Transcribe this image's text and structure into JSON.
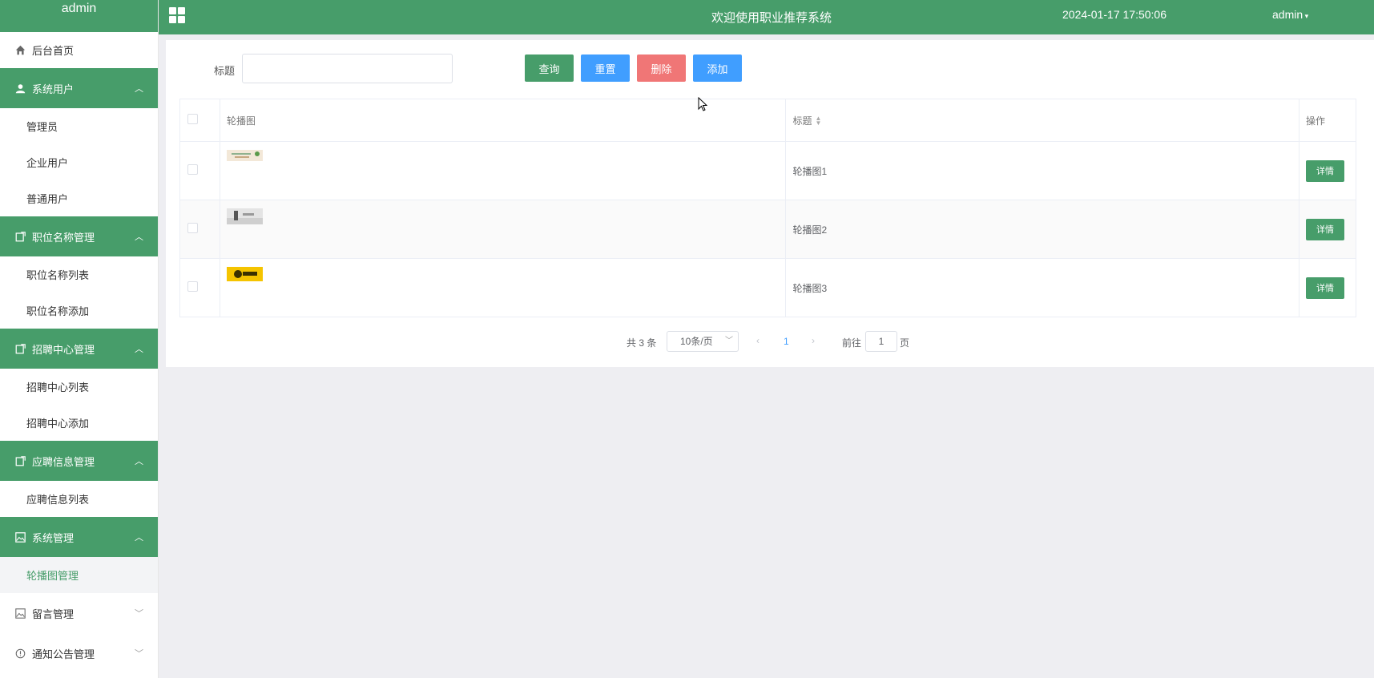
{
  "sidebar": {
    "brand": "admin",
    "home": "后台首页",
    "groups": [
      {
        "label": "系统用户",
        "icon": "user-icon",
        "items": [
          "管理员",
          "企业用户",
          "普通用户"
        ]
      },
      {
        "label": "职位名称管理",
        "icon": "edit-doc-icon",
        "items": [
          "职位名称列表",
          "职位名称添加"
        ]
      },
      {
        "label": "招聘中心管理",
        "icon": "edit-doc-icon",
        "items": [
          "招聘中心列表",
          "招聘中心添加"
        ]
      },
      {
        "label": "应聘信息管理",
        "icon": "edit-doc-icon",
        "items": [
          "应聘信息列表"
        ]
      },
      {
        "label": "系统管理",
        "icon": "image-icon",
        "items": [
          "轮播图管理"
        ]
      }
    ],
    "closed": [
      {
        "label": "留言管理",
        "icon": "image-icon"
      },
      {
        "label": "通知公告管理",
        "icon": "info-icon"
      }
    ]
  },
  "header": {
    "title": "欢迎使用职业推荐系统",
    "datetime": "2024-01-17 17:50:06",
    "user": "admin"
  },
  "search": {
    "label": "标题",
    "value": "",
    "placeholder": ""
  },
  "buttons": {
    "query": "查询",
    "reset": "重置",
    "delete": "删除",
    "add": "添加"
  },
  "table": {
    "columns": [
      "轮播图",
      "标题",
      "操作"
    ],
    "rows": [
      {
        "title": "轮播图1",
        "action": "详情"
      },
      {
        "title": "轮播图2",
        "action": "详情"
      },
      {
        "title": "轮播图3",
        "action": "详情"
      }
    ]
  },
  "pagination": {
    "total": "共 3 条",
    "page_size": "10条/页",
    "current_page": "1",
    "goto_label": "前往",
    "goto_value": "1",
    "goto_unit": "页"
  },
  "colors": {
    "primary": "#479d6a",
    "blue": "#409eff",
    "danger": "#f07676"
  }
}
